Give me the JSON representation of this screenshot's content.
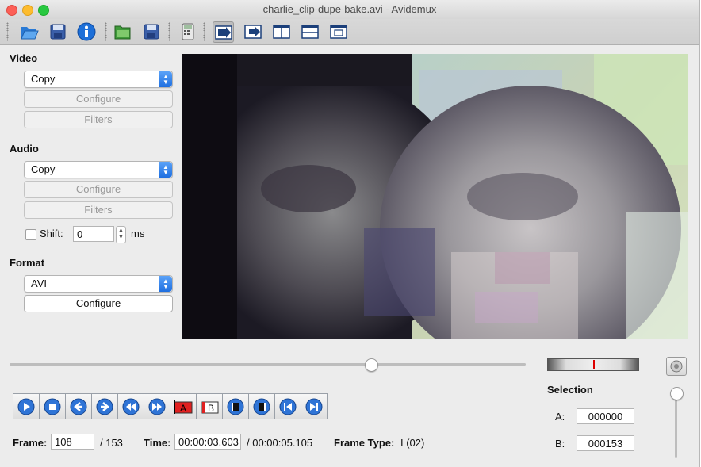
{
  "window": {
    "title": "charlie_clip-dupe-bake.avi - Avidemux"
  },
  "toolbar": {
    "items": [
      "open-icon",
      "save-video-icon",
      "info-icon",
      "open-folder-icon",
      "save-project-icon",
      "calculator-icon",
      "play-filtered-icon",
      "output-icon",
      "split-view-icon",
      "horizontal-split-icon",
      "fullscreen-icon"
    ]
  },
  "video": {
    "label": "Video",
    "codec": "Copy",
    "configure": "Configure",
    "filters": "Filters"
  },
  "audio": {
    "label": "Audio",
    "codec": "Copy",
    "configure": "Configure",
    "filters": "Filters",
    "shift_label": "Shift:",
    "shift_value": "0",
    "shift_unit": "ms"
  },
  "format": {
    "label": "Format",
    "container": "AVI",
    "configure": "Configure"
  },
  "playback": {
    "position_fraction": 0.7
  },
  "status": {
    "frame_label": "Frame:",
    "frame_value": "108",
    "frame_total": "/ 153",
    "time_label": "Time:",
    "time_value": "00:00:03.603",
    "time_total": "/ 00:00:05.105",
    "frame_type_label": "Frame Type:",
    "frame_type_value": "I (02)"
  },
  "selection": {
    "label": "Selection",
    "a_label": "A:",
    "a_value": "000000",
    "b_label": "B:",
    "b_value": "000153"
  },
  "colors": {
    "accent": "#1f6fe0",
    "video_dark": "#1c1a24"
  }
}
